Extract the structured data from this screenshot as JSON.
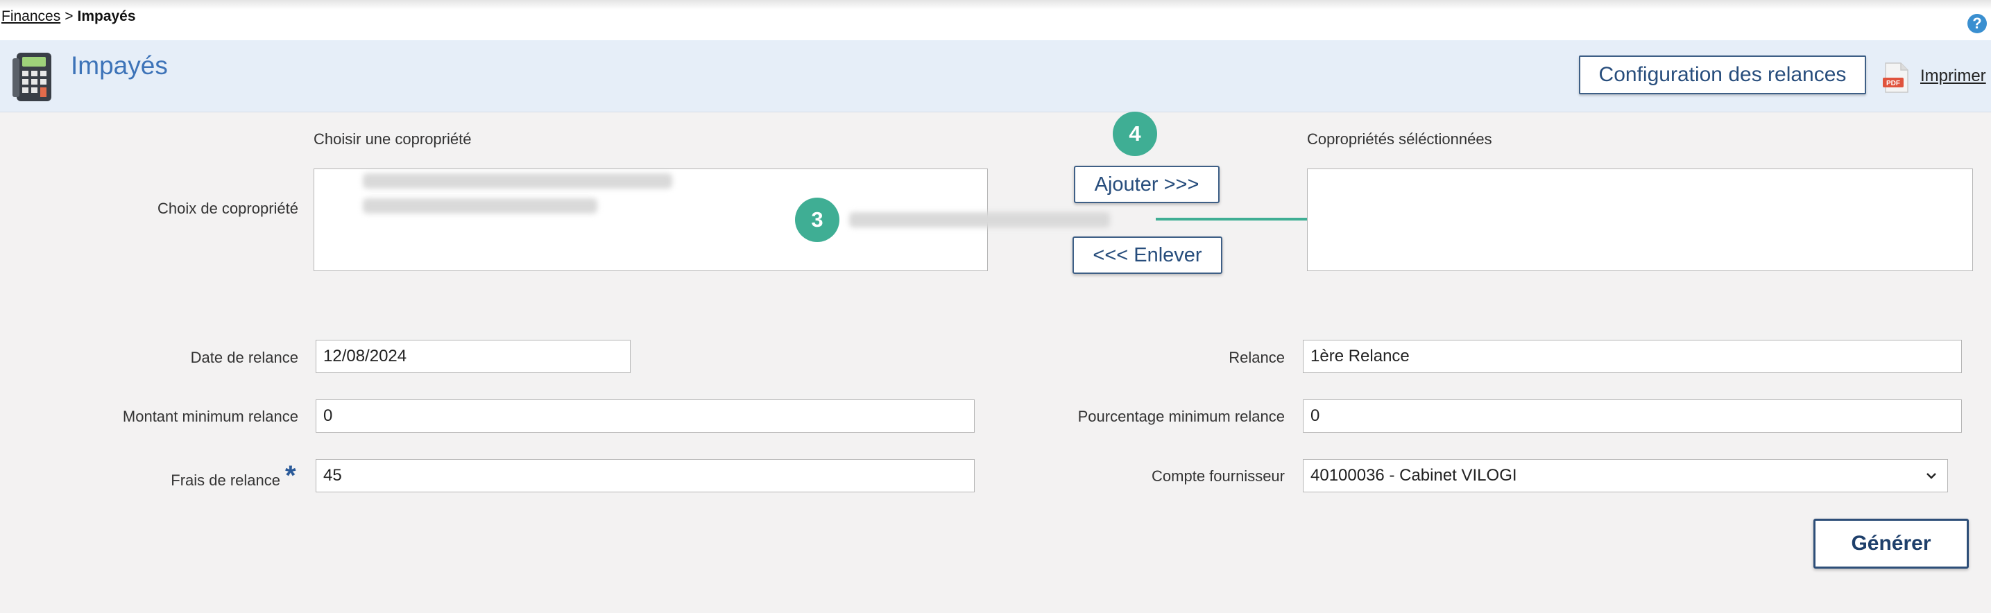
{
  "breadcrumb": {
    "parent": "Finances",
    "separator": ">",
    "current": "Impayés"
  },
  "help": {
    "glyph": "?"
  },
  "header": {
    "title": "Impayés",
    "config_button": "Configuration des relances",
    "print_label": "Imprimer",
    "pdf_icon_text": "PDF"
  },
  "selection": {
    "choose_label": "Choisir une copropriété",
    "field_label": "Choix de copropriété",
    "selected_label": "Copropriétés séléctionnées",
    "add_button": "Ajouter >>>",
    "remove_button": "<<< Enlever"
  },
  "steps": {
    "step3": "3",
    "step4": "4"
  },
  "form": {
    "date_label": "Date de relance",
    "date_value": "12/08/2024",
    "relance_label": "Relance",
    "relance_value": "1ère Relance",
    "montant_label": "Montant minimum relance",
    "montant_value": "0",
    "pourcentage_label": "Pourcentage minimum relance",
    "pourcentage_value": "0",
    "frais_label": "Frais de relance",
    "frais_required": "*",
    "frais_value": "45",
    "compte_label": "Compte fournisseur",
    "compte_value": "40100036 - Cabinet VILOGI"
  },
  "generate_button": "Générer",
  "colors": {
    "accent": "#3fae94",
    "primary": "#274d7c",
    "title": "#3d73b8",
    "header_bg": "#e6eef8"
  }
}
